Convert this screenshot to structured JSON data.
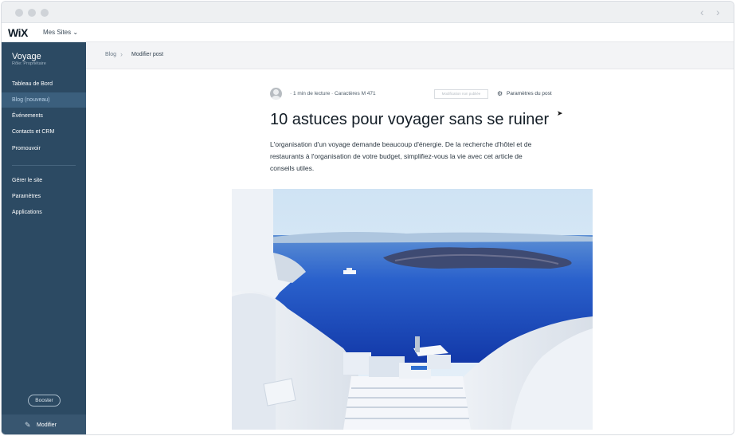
{
  "browser": {
    "back_icon": "chevron-left-icon",
    "forward_icon": "chevron-right-icon"
  },
  "topbar": {
    "logo": "WiX",
    "my_sites": "Mes Sites"
  },
  "sidebar": {
    "site_name": "Voyage",
    "site_role": "Rôle: Propriétaire",
    "items": [
      {
        "label": "Tableau de Bord",
        "active": false
      },
      {
        "label": "Blog (nouveau)",
        "active": true
      },
      {
        "label": "Événements",
        "active": false
      },
      {
        "label": "Contacts et CRM",
        "active": false
      },
      {
        "label": "Promouvoir",
        "active": false
      }
    ],
    "items2": [
      {
        "label": "Gérer le site"
      },
      {
        "label": "Paramètres"
      },
      {
        "label": "Applications"
      }
    ],
    "booster_label": "Booster",
    "modifier_label": "Modifier"
  },
  "breadcrumb": {
    "parent": "Blog",
    "current": "Modifier post"
  },
  "post": {
    "meta": "· 1 min de lecture · Caractères M 471",
    "notification_placeholder": "Modification non publiée",
    "settings_label": "Paramètres du post",
    "title": "10 astuces pour voyager sans se ruiner",
    "excerpt": "L'organisation d'un voyage demande beaucoup d'énergie. De la recherche d'hôtel et de restaurants à l'organisation de votre budget, simplifiez-vous la vie avec cet article de conseils utiles."
  },
  "colors": {
    "sidebar_bg": "#2c4a63",
    "sidebar_active": "#3b5f7d",
    "sea": "#1f52c9"
  }
}
